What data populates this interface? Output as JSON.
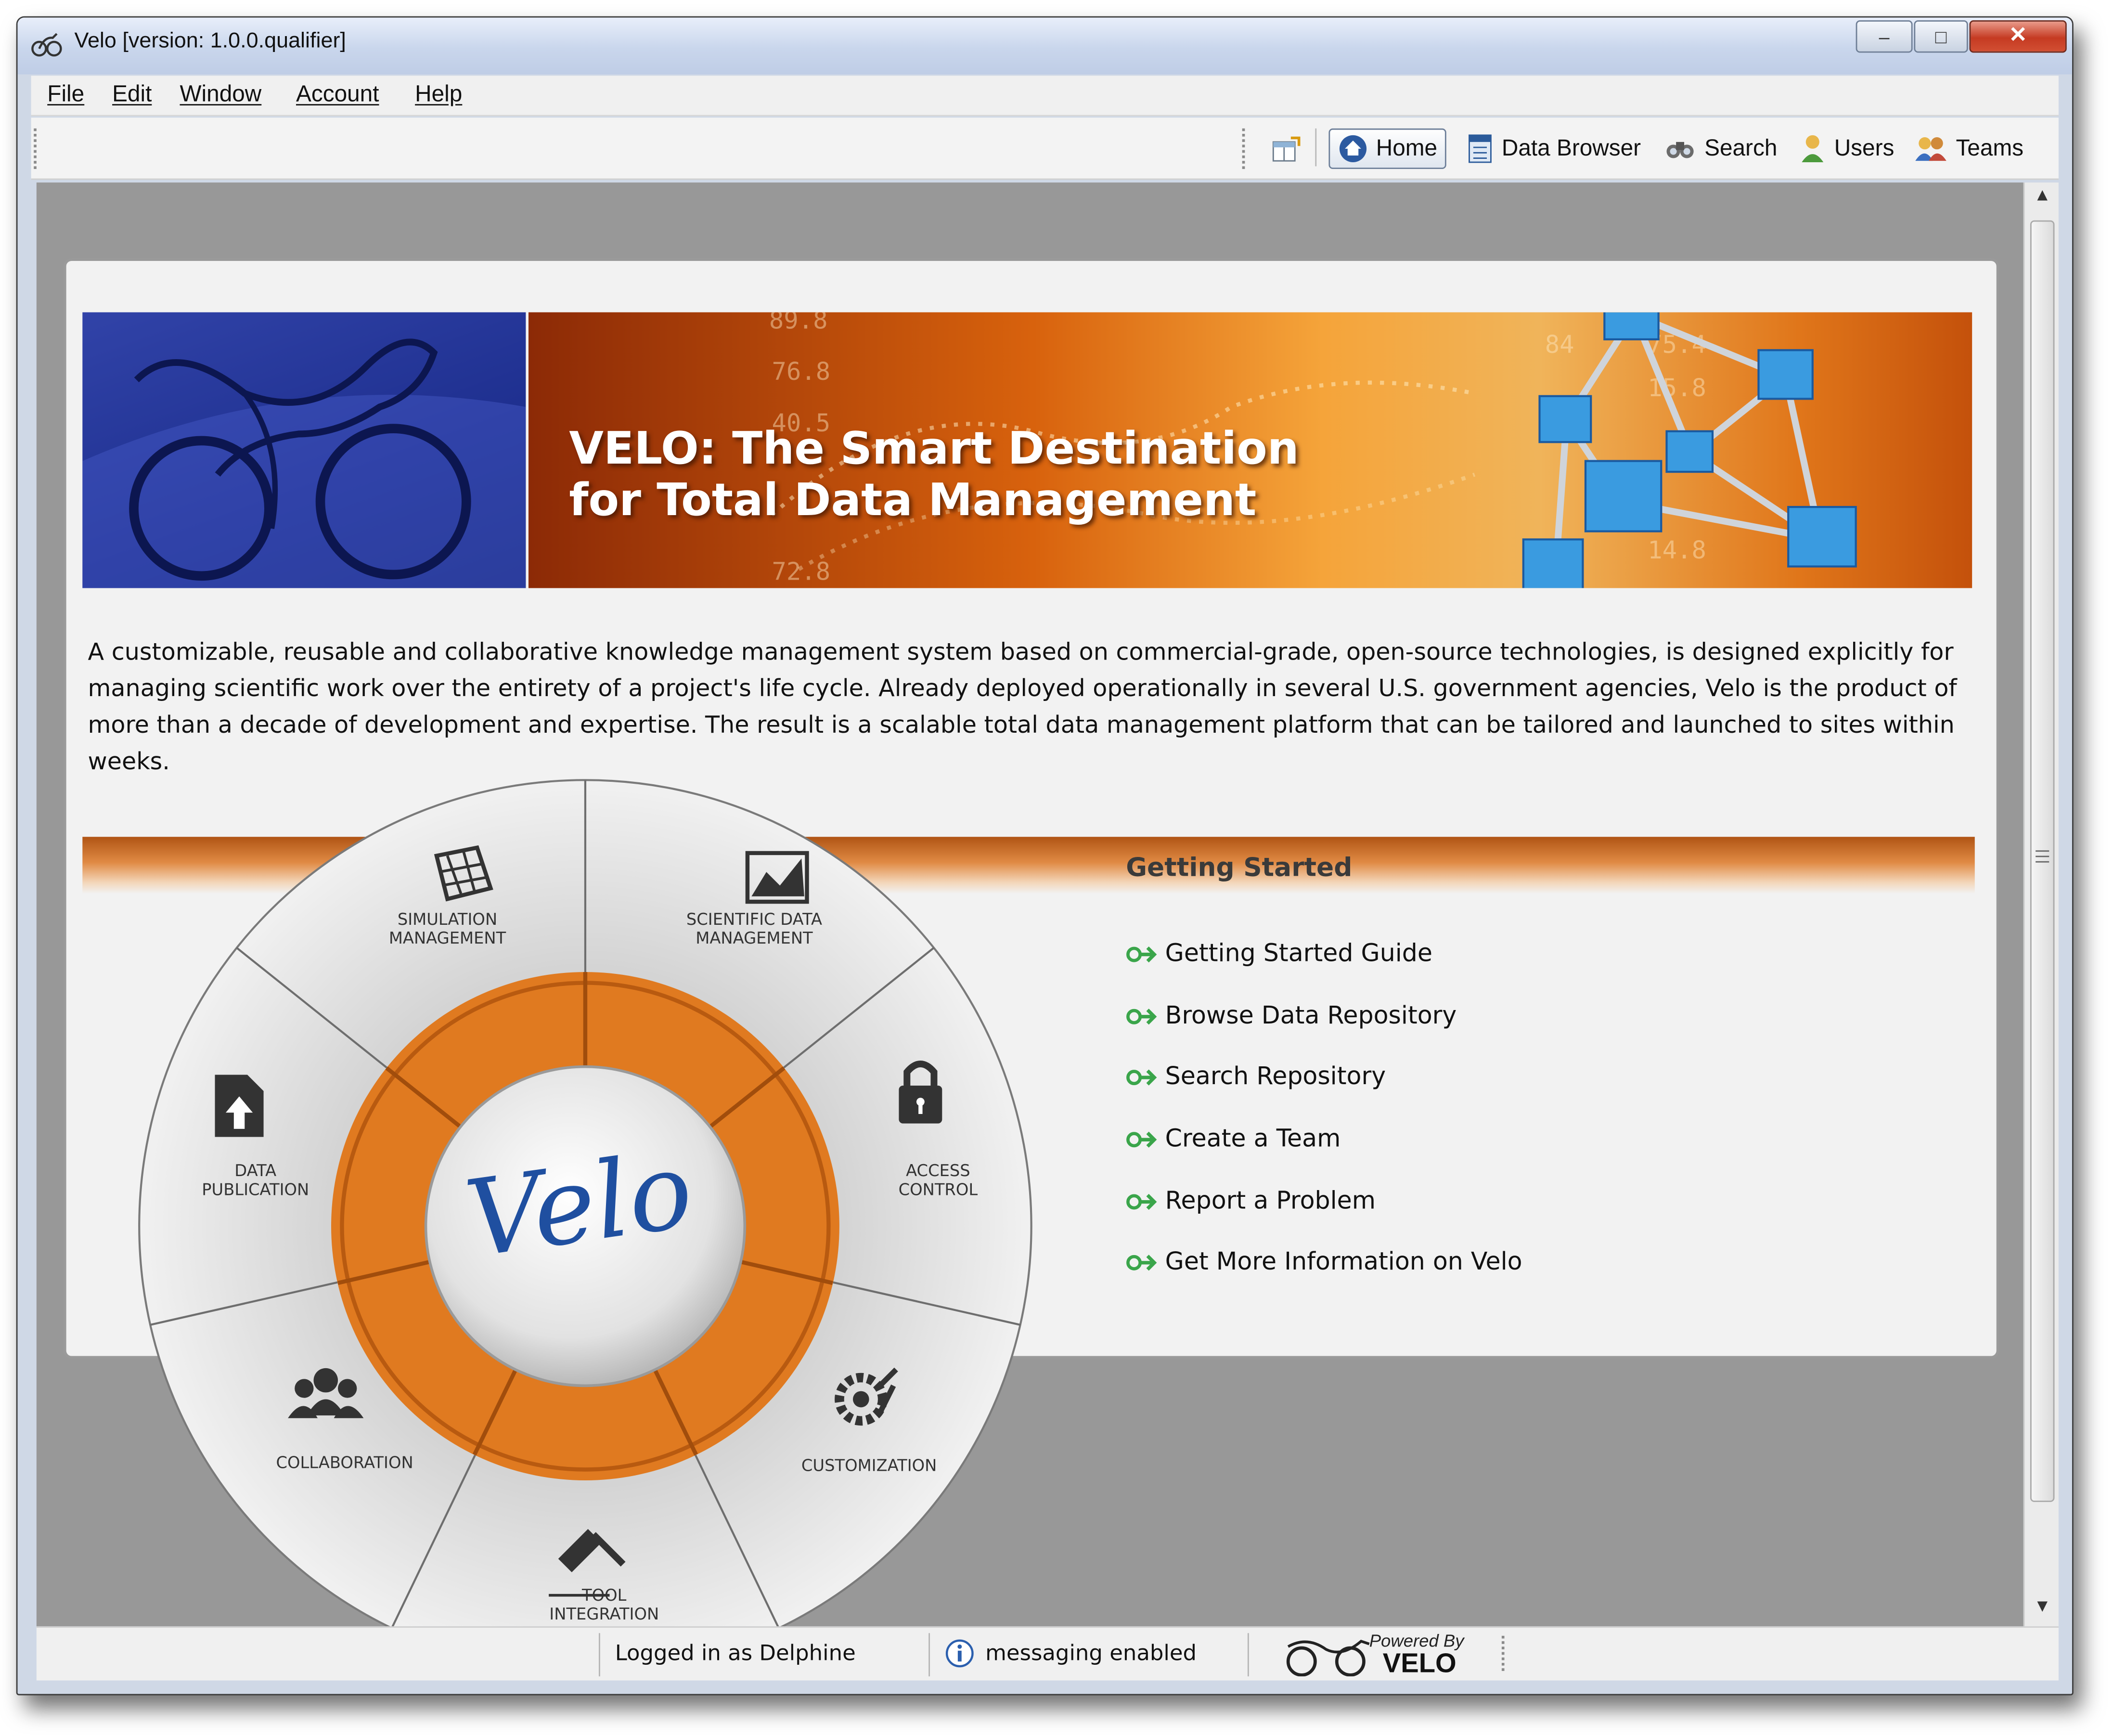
{
  "window": {
    "title": "Velo [version: 1.0.0.qualifier]",
    "controls": {
      "minimize": "–",
      "maximize": "□",
      "close": "✕"
    }
  },
  "menu": {
    "items": [
      {
        "label": "File"
      },
      {
        "label": "Edit"
      },
      {
        "label": "Window"
      },
      {
        "label": "Account"
      },
      {
        "label": "Help"
      }
    ]
  },
  "toolbar": {
    "home": "Home",
    "data_browser": "Data Browser",
    "search": "Search",
    "users": "Users",
    "teams": "Teams"
  },
  "banner": {
    "title_line1": "VELO: The Smart Destination",
    "title_line2": "for Total Data Management",
    "numbers": [
      "89.8",
      "76.8",
      "40.5",
      "84",
      "75.4",
      "15.8",
      "72.8",
      "14.8"
    ]
  },
  "description": "A customizable, reusable and collaborative knowledge management system based on commercial-grade, open-source technologies, is designed explicitly for managing scientific work over the entirety of a project's life cycle. Already deployed operationally in several U.S. government agencies, Velo is the product of more than a decade of development and expertise. The result is a scalable total data management platform that can be tailored and launched to sites within weeks.",
  "getting_started": {
    "title": "Getting Started",
    "links": [
      "Getting Started Guide",
      "Browse Data Repository",
      "Search Repository",
      "Create a Team",
      "Report a Problem",
      "Get More Information on Velo"
    ]
  },
  "wheel": {
    "center_logo": "Velo",
    "segments": {
      "simulation": [
        "SIMULATION",
        "MANAGEMENT"
      ],
      "scientific": [
        "SCIENTIFIC DATA",
        "MANAGEMENT"
      ],
      "access": [
        "ACCESS",
        "CONTROL"
      ],
      "customization": [
        "CUSTOMIZATION"
      ],
      "tool": [
        "TOOL",
        "INTEGRATION"
      ],
      "collaboration": [
        "COLLABORATION"
      ],
      "publication": [
        "DATA",
        "PUBLICATION"
      ]
    }
  },
  "status": {
    "logged_in": "Logged in as Delphine",
    "messaging": "messaging enabled",
    "powered_by": "Powered By",
    "powered_velo": "VELO"
  },
  "colors": {
    "accent_orange": "#e07a20",
    "link_arrow_green": "#3aa54a",
    "banner_blue": "#1e2f8f"
  }
}
